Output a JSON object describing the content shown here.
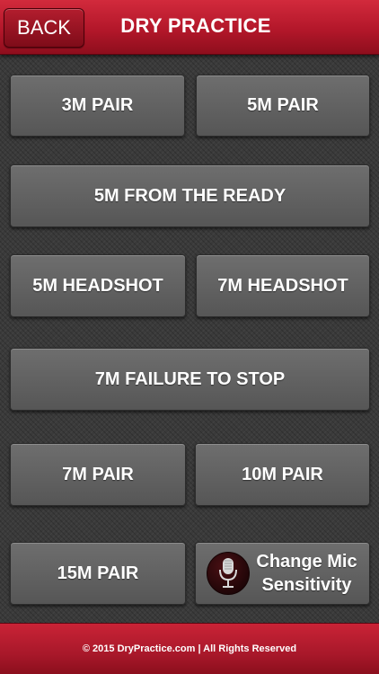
{
  "header": {
    "back_label": "BACK",
    "title": "DRY PRACTICE"
  },
  "drills": [
    {
      "label": "3M PAIR"
    },
    {
      "label": "5M PAIR"
    },
    {
      "label": "5M FROM THE READY"
    },
    {
      "label": "5M HEADSHOT"
    },
    {
      "label": "7M HEADSHOT"
    },
    {
      "label": "7M FAILURE TO STOP"
    },
    {
      "label": "7M PAIR"
    },
    {
      "label": "10M PAIR"
    },
    {
      "label": "15M PAIR"
    }
  ],
  "mic": {
    "label_line1": "Change Mic",
    "label_line2": "Sensitivity",
    "icon": "microphone-icon"
  },
  "footer": {
    "copyright": "© 2015 DryPractice.com | All Rights Reserved"
  },
  "colors": {
    "header_red": "#b3172a",
    "button_gray": "#626262",
    "background": "#3a3a3a"
  }
}
